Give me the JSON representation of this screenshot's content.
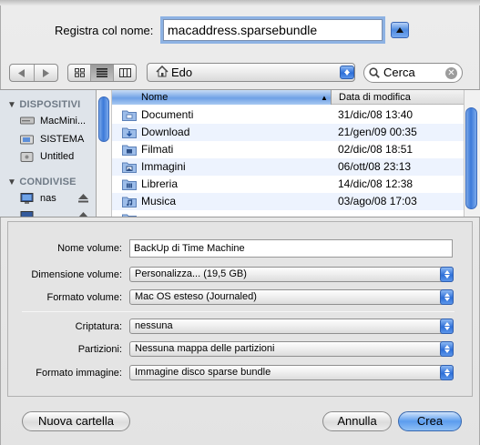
{
  "save_as": {
    "label": "Registra col nome:",
    "value": "macaddress.sparsebundle"
  },
  "toolbar": {
    "location": "Edo",
    "search_value": "Cerca"
  },
  "sidebar": {
    "sections": [
      {
        "title": "DISPOSITIVI",
        "items": [
          "MacMini...",
          "SISTEMA",
          "Untitled"
        ]
      },
      {
        "title": "CONDIVISE",
        "items": [
          "nas"
        ]
      }
    ]
  },
  "file_list": {
    "columns": [
      "Nome",
      "Data di modifica"
    ],
    "rows": [
      {
        "name": "Documenti",
        "date": "31/dic/08 13:40"
      },
      {
        "name": "Download",
        "date": "21/gen/09 00:35"
      },
      {
        "name": "Filmati",
        "date": "02/dic/08 18:51"
      },
      {
        "name": "Immagini",
        "date": "06/ott/08 23:13"
      },
      {
        "name": "Libreria",
        "date": "14/dic/08 12:38"
      },
      {
        "name": "Musica",
        "date": "03/ago/08 17:03"
      }
    ]
  },
  "options": {
    "volume_name": {
      "label": "Nome volume:",
      "value": "BackUp di Time Machine"
    },
    "volume_size": {
      "label": "Dimensione volume:",
      "value": "Personalizza... (19,5 GB)"
    },
    "volume_format": {
      "label": "Formato volume:",
      "value": "Mac OS esteso (Journaled)"
    },
    "encryption": {
      "label": "Criptatura:",
      "value": "nessuna"
    },
    "partitions": {
      "label": "Partizioni:",
      "value": "Nessuna mappa delle partizioni"
    },
    "image_format": {
      "label": "Formato immagine:",
      "value": "Immagine disco sparse bundle"
    }
  },
  "buttons": {
    "new_folder": "Nuova cartella",
    "cancel": "Annulla",
    "create": "Crea"
  },
  "colors": {
    "accent": "#5b9cee",
    "sidebar_bg": "#dfe4ea",
    "alt_row": "#edf3fe"
  }
}
